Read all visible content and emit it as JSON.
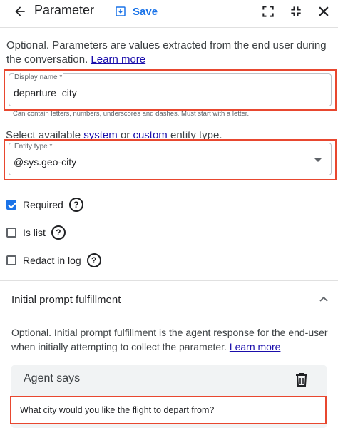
{
  "header": {
    "title": "Parameter",
    "save_label": "Save"
  },
  "intro": {
    "text": "Optional. Parameters are values extracted from the end user during the conversation.",
    "learn_more": "Learn more"
  },
  "display_name": {
    "label": "Display name *",
    "value": "departure_city",
    "hint": "Can contain letters, numbers, underscores and dashes. Must start with a letter."
  },
  "entity_select": {
    "prefix": "Select available",
    "system": "system",
    "or": "or",
    "custom": "custom",
    "suffix": "entity type."
  },
  "entity_type": {
    "label": "Entity type *",
    "value": "@sys.geo-city"
  },
  "options": {
    "required": "Required",
    "is_list": "Is list",
    "redact": "Redact in log",
    "help_glyph": "?"
  },
  "fulfillment": {
    "title": "Initial prompt fulfillment",
    "description": "Optional. Initial prompt fulfillment is the agent response for the end-user when initially attempting to collect the parameter.",
    "learn_more": "Learn more",
    "agent_says": "Agent says",
    "message": "What city would you like the flight to depart from?"
  },
  "colors": {
    "accent": "#1a73e8",
    "highlight": "#e8472f",
    "link": "#1a0dab"
  }
}
